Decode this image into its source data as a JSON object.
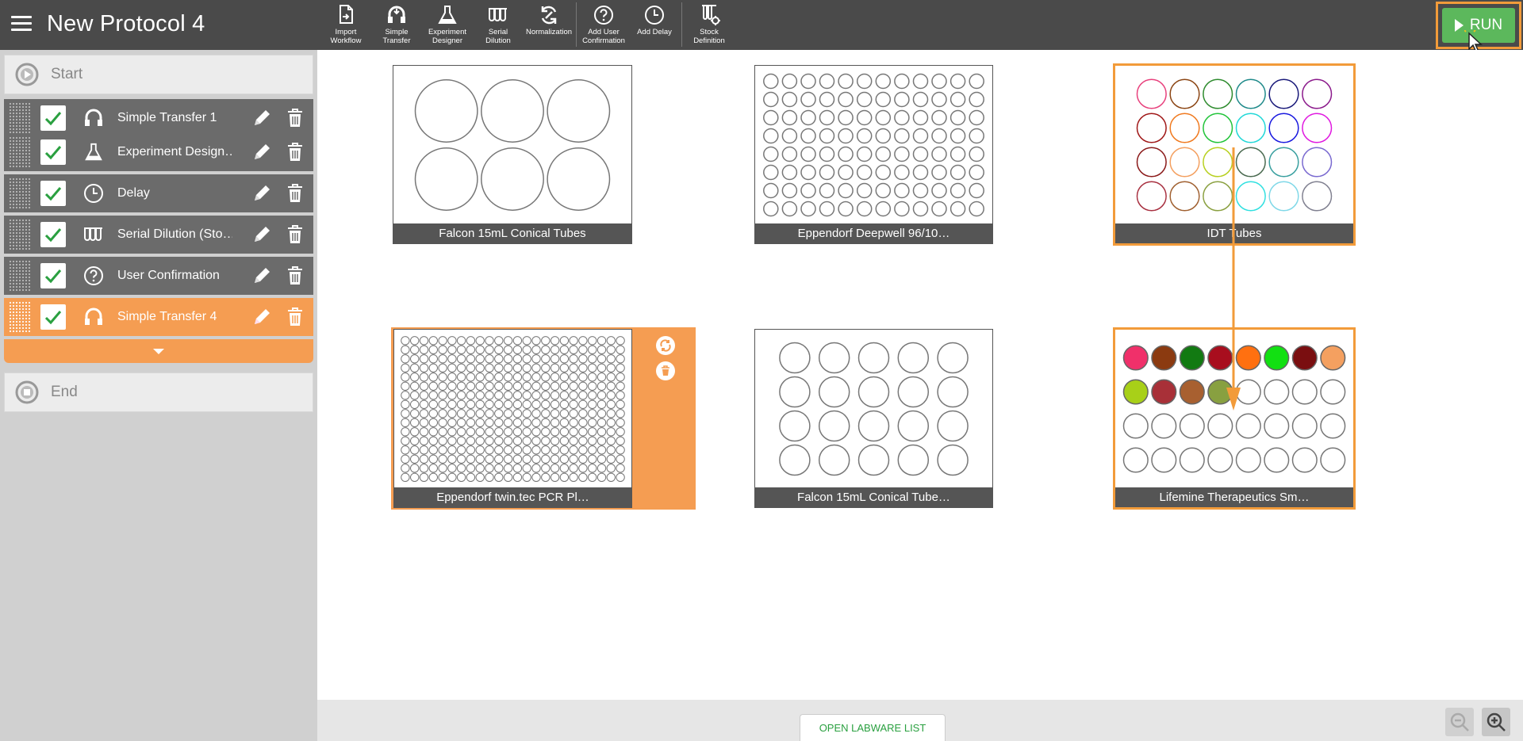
{
  "header": {
    "title": "New Protocol 4",
    "run_label": "RUN",
    "toolbar": [
      {
        "label": "Import\nWorkflow",
        "icon": "import-workflow-icon"
      },
      {
        "label": "Simple\nTransfer",
        "icon": "simple-transfer-icon"
      },
      {
        "label": "Experiment\nDesigner",
        "icon": "flask-icon"
      },
      {
        "label": "Serial\nDilution",
        "icon": "serial-dilution-icon"
      },
      {
        "label": "Normalization",
        "icon": "normalization-icon"
      },
      {
        "label": "Add User\nConfirmation",
        "icon": "question-icon"
      },
      {
        "label": "Add Delay",
        "icon": "clock-icon"
      },
      {
        "label": "Stock\nDefinition",
        "icon": "stock-definition-icon"
      }
    ]
  },
  "sidebar": {
    "start_label": "Start",
    "end_label": "End",
    "steps": [
      {
        "label": "Simple Transfer 1",
        "icon": "simple-transfer-icon",
        "checked": true,
        "active": false
      },
      {
        "label": "Experiment Design…",
        "icon": "flask-icon",
        "checked": true,
        "active": false
      },
      {
        "label": "Delay",
        "icon": "clock-icon",
        "checked": true,
        "active": false
      },
      {
        "label": "Serial Dilution (Sto…",
        "icon": "serial-dilution-icon",
        "checked": true,
        "active": false
      },
      {
        "label": "User Confirmation",
        "icon": "question-icon",
        "checked": true,
        "active": false
      },
      {
        "label": "Simple Transfer 4",
        "icon": "simple-transfer-icon",
        "checked": true,
        "active": true
      }
    ]
  },
  "labware": [
    {
      "label": "Falcon 15mL Conical Tubes",
      "rows": 2,
      "cols": 3,
      "selected": false,
      "active": false
    },
    {
      "label": "Eppendorf Deepwell 96/10…",
      "rows": 8,
      "cols": 12,
      "selected": false,
      "active": false
    },
    {
      "label": "IDT Tubes",
      "rows": 4,
      "cols": 6,
      "selected": true,
      "active": false,
      "well_colors": [
        "#e8417d",
        "#8b4513",
        "#2e8b2e",
        "#1f8a8a",
        "#1a1a7a",
        "#8b1a8b",
        "#a01818",
        "#f07a20",
        "#22c43a",
        "#22d8d8",
        "#1a1adf",
        "#e01ae0",
        "#8b1a1a",
        "#f4a060",
        "#b8d020",
        "#4a6a50",
        "#3aa0a0",
        "#7a6ad0",
        "#a83040",
        "#a06030",
        "#8aa040",
        "#30e0e0",
        "#80d8e8",
        "#808090"
      ]
    },
    {
      "label": "Eppendorf twin.tec PCR Pl…",
      "rows": 16,
      "cols": 24,
      "selected": false,
      "active": true
    },
    {
      "label": "Falcon 15mL Conical Tube…",
      "rows": 4,
      "cols": 5,
      "selected": false,
      "active": false
    },
    {
      "label": "Lifemine Therapeutics Sm…",
      "rows": 4,
      "cols": 8,
      "selected": true,
      "active": false,
      "well_fills": [
        "#f0306a",
        "#8b3a10",
        "#127a12",
        "#a80e1e",
        "#ff7010",
        "#12e012",
        "#7a0e10",
        "#f4a060",
        "#a8d018",
        "#a83038",
        "#a86030",
        "#88a040"
      ]
    }
  ],
  "bottom": {
    "open_list_label": "OPEN LABWARE LIST"
  },
  "colors": {
    "header_bg": "#4a4a4a",
    "run_green": "#5cb85c",
    "accent_orange": "#f29b3a",
    "active_step": "#f59d52",
    "step_bg": "#6b6b6b",
    "check_green": "#2aa040"
  }
}
